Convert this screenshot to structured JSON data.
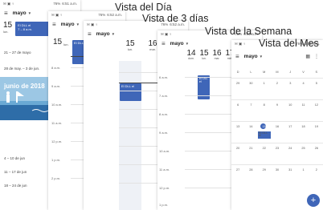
{
  "captions": {
    "day": "Vista del Día",
    "three_day": "Vista de 3 días",
    "week": "Vista de la Semana",
    "month": "Vista del Mes"
  },
  "status_bar": {
    "battery": "76%",
    "time_a": "6:51 a.m.",
    "time_b": "6:52 a.m."
  },
  "month_name": "mayo",
  "schedule": {
    "day_num": "15",
    "day_name": "lun.",
    "event_title": "El DLL el",
    "event_time": "7 – 8 a.m.",
    "weeks": [
      "21 – 27 de mayo",
      "28 de may. – 3 de jun."
    ],
    "banner": "junio de 2018",
    "bottom_weeks": [
      "4 – 10 de jun",
      "11 – 17 de jun",
      "18 – 24 de jun"
    ]
  },
  "day_view": {
    "day_num": "15",
    "day_name": "lun.",
    "event_title": "El DLL el",
    "times": [
      "8 a.m.",
      "9 a.m.",
      "10 a.m.",
      "11 a.m.",
      "12 p.m.",
      "1 p.m.",
      "2 p.m."
    ]
  },
  "three_day_view": {
    "days": [
      {
        "num": "15",
        "name": "lun."
      },
      {
        "num": "16",
        "name": "mar."
      }
    ],
    "event_title": "El DLL el",
    "times": [
      "6 a.m.",
      "7 a.m.",
      "8 a.m.",
      "9 a.m.",
      "10 a.m.",
      "11 a.m.",
      "12 p.m.",
      "1 p.m."
    ]
  },
  "week_view": {
    "days": [
      {
        "num": "14",
        "name": "dom."
      },
      {
        "num": "15",
        "name": "lun."
      },
      {
        "num": "16",
        "name": "mar."
      },
      {
        "num": "17",
        "name": "mié."
      }
    ],
    "event_title": "El DLL el",
    "times": [
      "6 a.m.",
      "7 a.m.",
      "8 a.m.",
      "9 a.m.",
      "10 a.m.",
      "11 a.m.",
      "12 p.m.",
      "1 p.m."
    ]
  },
  "month_view": {
    "weekday_headers": [
      "D",
      "L",
      "M",
      "M",
      "J",
      "V",
      "S"
    ],
    "weeks": [
      [
        "29",
        "30",
        "1",
        "2",
        "3",
        "4",
        "5"
      ],
      [
        "6",
        "7",
        "8",
        "9",
        "10",
        "11",
        "12"
      ],
      [
        "13",
        "14",
        "15",
        "16",
        "17",
        "18",
        "19"
      ],
      [
        "20",
        "21",
        "22",
        "23",
        "24",
        "25",
        "26"
      ],
      [
        "27",
        "28",
        "29",
        "30",
        "31",
        "1",
        "2"
      ]
    ],
    "event_title": "El DLL el",
    "fab_label": "+"
  },
  "accent_color": "#3f66b8"
}
